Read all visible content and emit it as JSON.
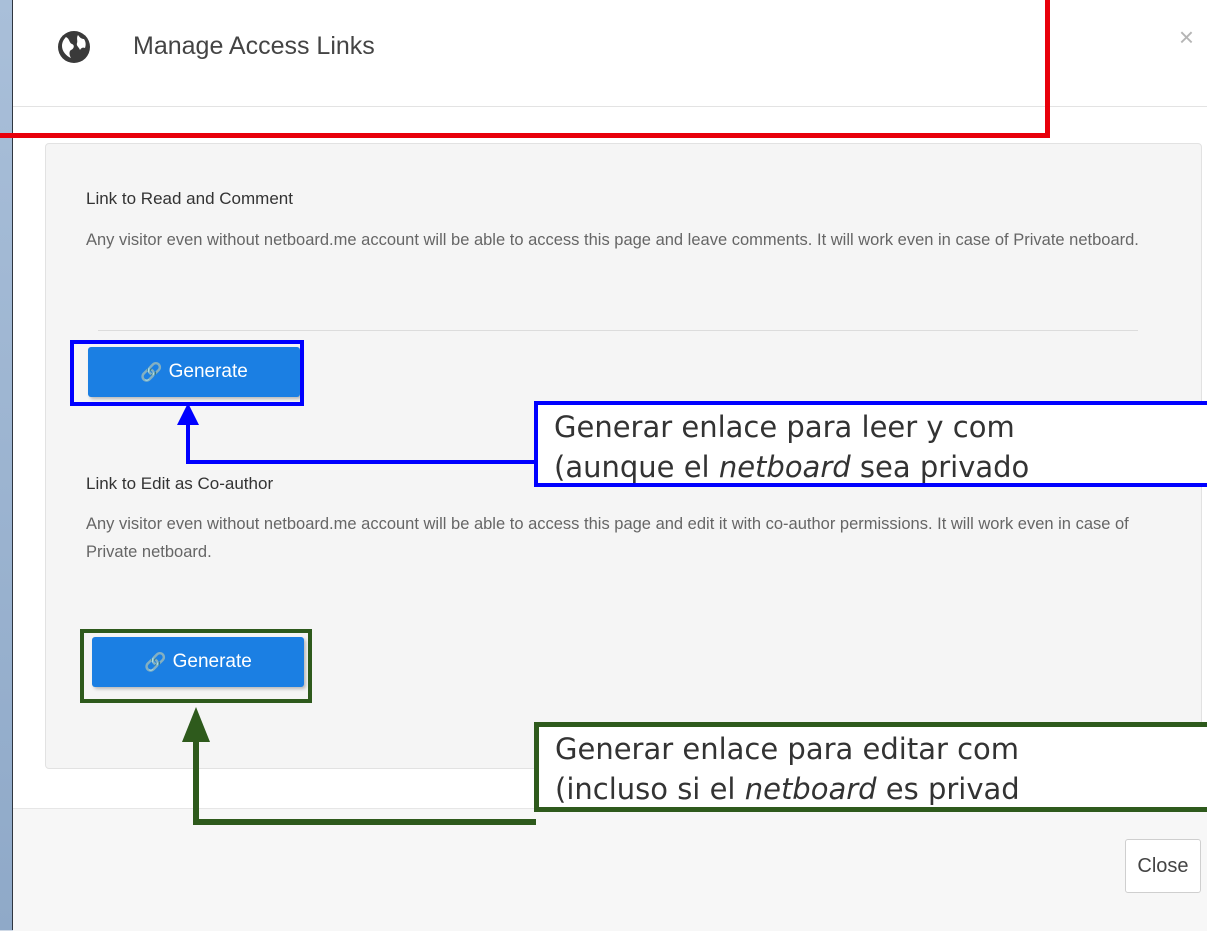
{
  "dialog": {
    "title": "Manage Access Links",
    "close_icon": "close-icon",
    "globe_icon": "globe-icon"
  },
  "sections": [
    {
      "title": "Link to Read and Comment",
      "description": "Any visitor even without netboard.me account will be able to access this page and leave comments. It will work even in case of Private netboard.",
      "button_label": "Generate",
      "button_icon": "link-icon"
    },
    {
      "title": "Link to Edit as Co-author",
      "description": "Any visitor even without netboard.me account will be able to access this page and edit it with co-author permissions. It will work even in case of Private netboard.",
      "button_label": "Generate",
      "button_icon": "link-icon"
    }
  ],
  "footer": {
    "close_label": "Close"
  },
  "annotations": {
    "read": {
      "line1": "Generar enlace para leer y com",
      "line2_pre": "(aunque el ",
      "line2_em": "netboard",
      "line2_post": " sea privado"
    },
    "edit": {
      "line1": "Generar enlace para editar com",
      "line2_pre": "(incluso si el ",
      "line2_em": "netboard",
      "line2_post": " es privad"
    }
  },
  "colors": {
    "header_highlight": "#e8000b",
    "read_annotation": "#0000ff",
    "edit_annotation": "#2e5a1c",
    "button": "#1b7fe3"
  }
}
